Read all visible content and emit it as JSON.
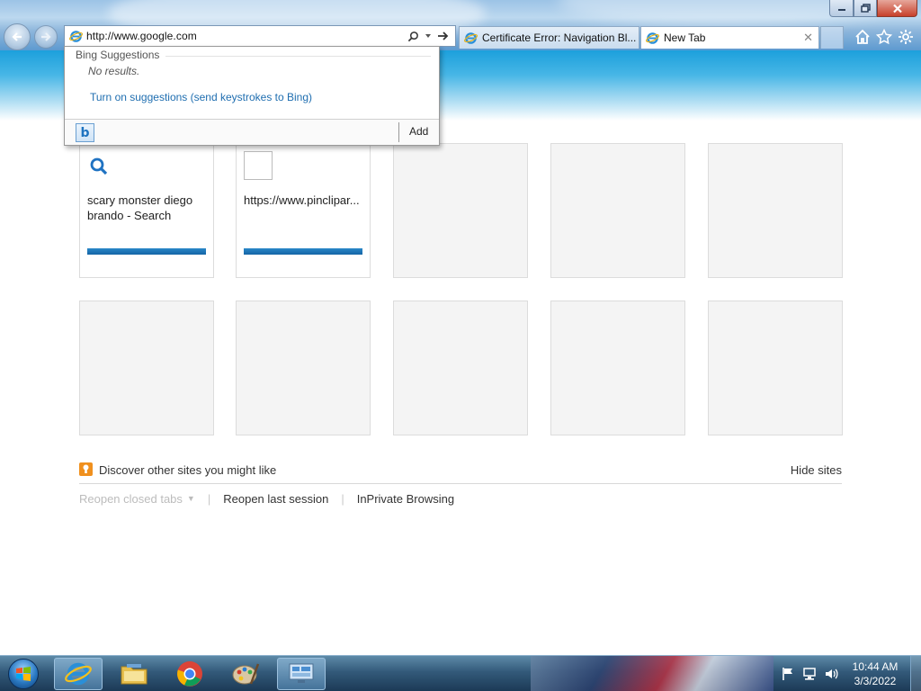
{
  "address": {
    "value": "http://www.google.com"
  },
  "tabs": [
    {
      "label": "Certificate Error: Navigation Bl...",
      "active": false
    },
    {
      "label": "New Tab",
      "active": true,
      "close": "✕"
    }
  ],
  "suggestions": {
    "header": "Bing Suggestions",
    "empty": "No results.",
    "turn_on": "Turn on suggestions (send keystrokes to Bing)",
    "add": "Add",
    "bing_letter": "b"
  },
  "tiles": [
    {
      "title": "scary monster diego brando - Search",
      "icon": "search-icon",
      "filled": true
    },
    {
      "title": "https://www.pinclipar...",
      "icon": "favicon",
      "filled": true
    },
    {
      "title": "",
      "filled": false
    },
    {
      "title": "",
      "filled": false
    },
    {
      "title": "",
      "filled": false
    },
    {
      "title": "",
      "filled": false
    },
    {
      "title": "",
      "filled": false
    },
    {
      "title": "",
      "filled": false
    },
    {
      "title": "",
      "filled": false
    },
    {
      "title": "",
      "filled": false
    }
  ],
  "discover": {
    "text": "Discover other sites you might like",
    "hide": "Hide sites"
  },
  "links": {
    "reopen_closed": "Reopen closed tabs",
    "reopen_last": "Reopen last session",
    "inprivate": "InPrivate Browsing",
    "separator": "|"
  },
  "taskbar": {
    "apps": [
      "internet-explorer",
      "windows-explorer",
      "chrome",
      "paint",
      "remote-desktop"
    ]
  },
  "clock": {
    "time": "10:44 AM",
    "date": "3/3/2022"
  },
  "colors": {
    "link": "#1f6eb0",
    "banner": "#1ca0dc",
    "tile_bar": "#1465a6",
    "discover_icon": "#f0901e"
  }
}
